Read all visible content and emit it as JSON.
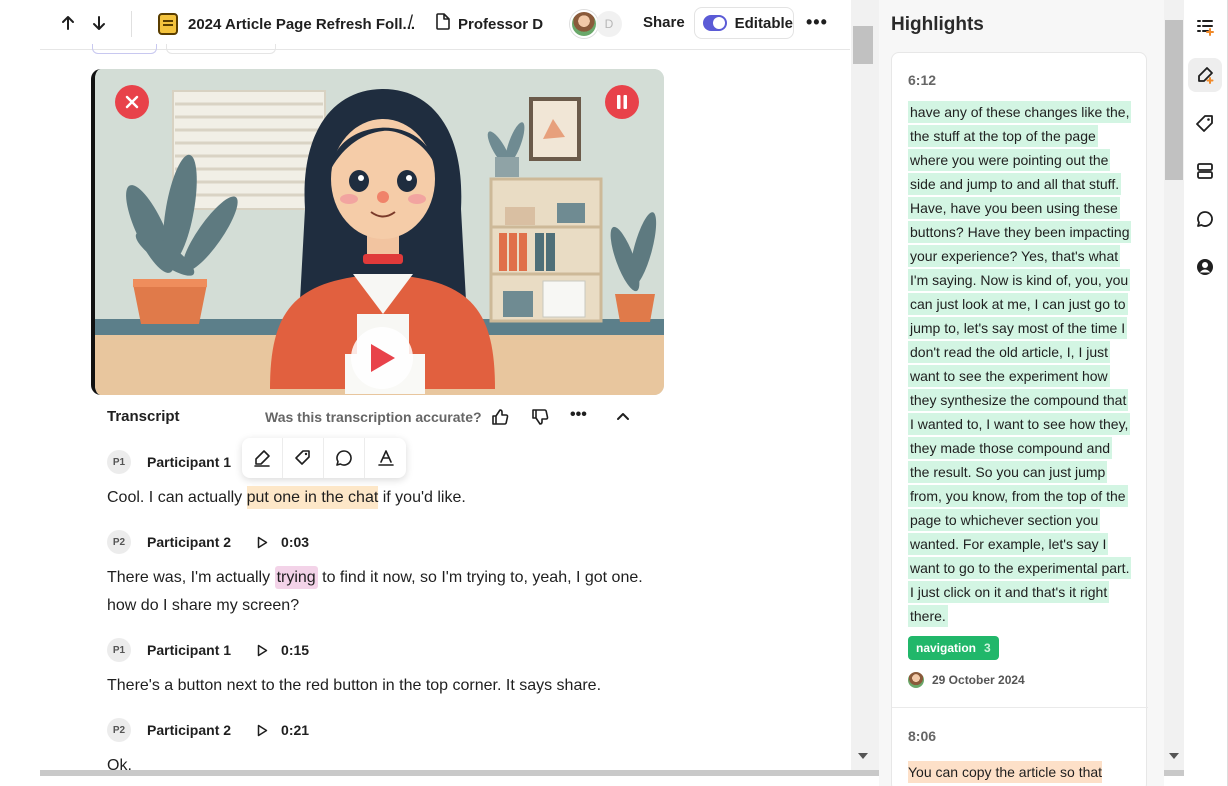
{
  "topbar": {
    "project_title": "2024 Article Page Refresh Foll...",
    "separator": "/",
    "doc_title": "Professor D",
    "avatar_letter": "D",
    "share_label": "Share",
    "editable_label": "Editable",
    "more_label": "•••"
  },
  "transcript": {
    "title": "Transcript",
    "accuracy_prompt": "Was this transcription accurate?",
    "more_label": "•••",
    "utterances": [
      {
        "chip": "P1",
        "speaker": "Participant 1",
        "time": "",
        "text_before": "Cool. I can actually ",
        "highlight": "put one in the chat",
        "text_after": " if you'd like."
      },
      {
        "chip": "P2",
        "speaker": "Participant 2",
        "time": "0:03",
        "text_before": "There was, I'm actually ",
        "highlight": "trying",
        "text_after": " to find it now, so I'm trying to, yeah, I got one. how do I share my screen?"
      },
      {
        "chip": "P1",
        "speaker": "Participant 1",
        "time": "0:15",
        "text": "There's a button next to the red button in the top corner. It says share."
      },
      {
        "chip": "P2",
        "speaker": "Participant 2",
        "time": "0:21",
        "text": "Ok."
      }
    ]
  },
  "highlights": {
    "title": "Highlights",
    "items": [
      {
        "time": "6:12",
        "quote": "have any of these changes like the, the stuff at the top of the page where you were pointing out the side and jump to and all that stuff. Have, have you been using these buttons? Have they been impacting your experience? Yes, that's what I'm saying. Now is kind of, you, you can just look at me, I can just go to jump to, let's say most of the time I don't read the old article, I, I just want to see the experiment how they synthesize the compound that I wanted to, I want to see how they, they made those compound and the result. So you can just jump from, you know, from the top of the page to whichever section you wanted. For example, let's say I want to go to the experimental part. I just click on it and that's it right there.",
        "tag": "navigation",
        "tag_count": "3",
        "date": "29 October 2024"
      },
      {
        "time": "8:06",
        "quote": "You can copy the article so that"
      }
    ]
  },
  "colors": {
    "accent": "#5b5bd6",
    "highlight_green": "#d3f5e3",
    "highlight_orange": "#fde7c8",
    "highlight_pink": "#f3d3e8",
    "tag_green": "#21b76a",
    "video_button_red": "#e8424a"
  },
  "icons": {
    "rail": [
      "highlights-list-icon",
      "highlighter-icon",
      "tag-icon",
      "layers-icon",
      "comment-icon",
      "user-circle-icon"
    ],
    "selection_toolbar": [
      "highlighter-icon",
      "tag-icon",
      "comment-icon",
      "text-color-icon"
    ]
  }
}
